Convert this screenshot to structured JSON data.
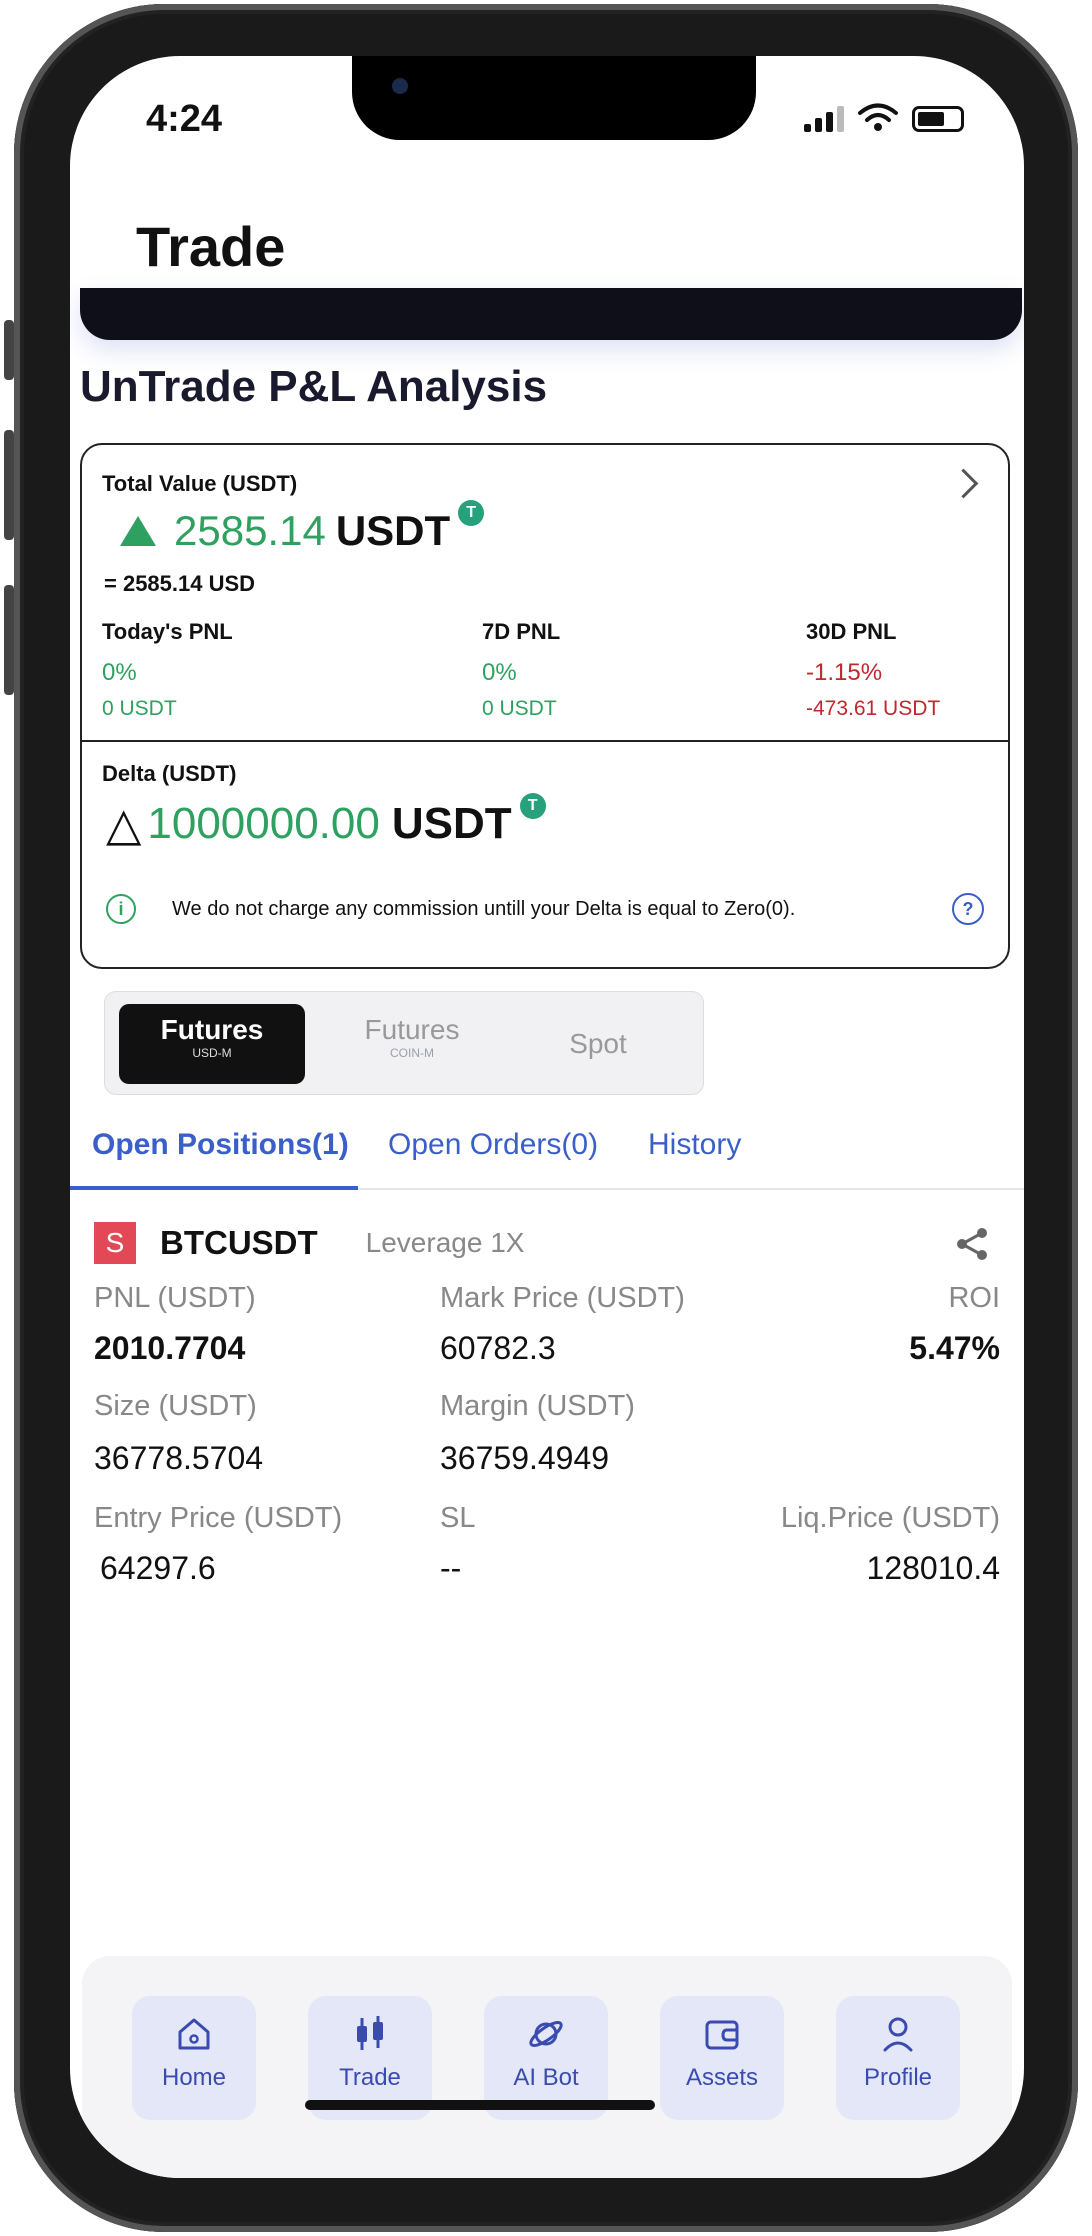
{
  "status_bar": {
    "time": "4:24"
  },
  "header": {
    "title": "Trade"
  },
  "section": {
    "title": "UnTrade P&L Analysis"
  },
  "pnl_card": {
    "total_value_label": "Total Value (USDT)",
    "total_value": "2585.14",
    "total_value_unit": "USDT",
    "total_value_usd": "= 2585.14 USD",
    "token_icon": "T",
    "today": {
      "label": "Today's PNL",
      "pct": "0%",
      "amount": "0 USDT"
    },
    "week": {
      "label": "7D PNL",
      "pct": "0%",
      "amount": "0 USDT"
    },
    "month": {
      "label": "30D PNL",
      "pct": "-1.15%",
      "amount": "-473.61 USDT"
    },
    "delta_label": "Delta (USDT)",
    "delta_symbol": "△",
    "delta_value": "1000000.00",
    "delta_unit": "USDT",
    "info_icon": "i",
    "info_text": "We do not charge any commission untill your Delta is equal to Zero(0).",
    "help_icon": "?"
  },
  "segments": [
    {
      "main": "Futures",
      "sub": "USD-M"
    },
    {
      "main": "Futures",
      "sub": "COIN-M"
    },
    {
      "main": "Spot",
      "sub": ""
    }
  ],
  "tabs": [
    {
      "label": "Open Positions(1)"
    },
    {
      "label": "Open Orders(0)"
    },
    {
      "label": "History"
    }
  ],
  "position": {
    "side_badge": "S",
    "symbol": "BTCUSDT",
    "leverage": "Leverage 1X",
    "pnl_label": "PNL (USDT)",
    "pnl_value": "2010.7704",
    "mark_price_label": "Mark Price (USDT)",
    "mark_price_value": "60782.3",
    "roi_label": "ROI",
    "roi_value": "5.47%",
    "size_label": "Size (USDT)",
    "size_value": "36778.5704",
    "margin_label": "Margin (USDT)",
    "margin_value": "36759.4949",
    "entry_label": "Entry Price (USDT)",
    "entry_value": "64297.6",
    "sl_label": "SL",
    "sl_value": "--",
    "liq_label": "Liq.Price (USDT)",
    "liq_value": "128010.4"
  },
  "nav": [
    {
      "label": "Home",
      "icon": "home-icon"
    },
    {
      "label": "Trade",
      "icon": "candlestick-icon"
    },
    {
      "label": "AI Bot",
      "icon": "planet-icon"
    },
    {
      "label": "Assets",
      "icon": "wallet-icon"
    },
    {
      "label": "Profile",
      "icon": "user-icon"
    }
  ],
  "colors": {
    "green": "#2ea160",
    "red": "#c0282d",
    "blue": "#3a5fc8",
    "badge": "#e24855"
  }
}
